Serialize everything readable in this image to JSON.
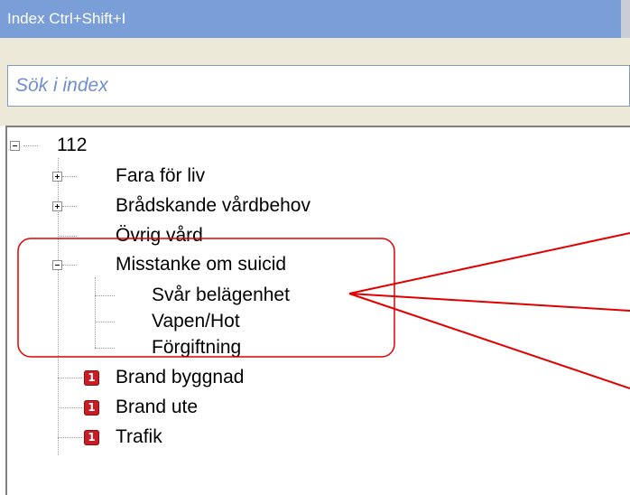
{
  "window": {
    "title": "Index Ctrl+Shift+I"
  },
  "search": {
    "placeholder": "Sök i index",
    "value": ""
  },
  "tree": {
    "root": {
      "label": "112",
      "expanded": true
    },
    "items": [
      {
        "label": "Fara för liv",
        "expanded": false
      },
      {
        "label": "Brådskande vårdbehov",
        "expanded": false
      },
      {
        "label": "Övrig vård"
      },
      {
        "label": "Misstanke om suicid",
        "expanded": true,
        "children": [
          {
            "label": "Svår belägenhet"
          },
          {
            "label": "Vapen/Hot"
          },
          {
            "label": "Förgiftning"
          }
        ]
      },
      {
        "label": "Brand byggnad",
        "badge": "1"
      },
      {
        "label": "Brand ute",
        "badge": "1"
      },
      {
        "label": "Trafik",
        "badge": "1"
      }
    ]
  },
  "colors": {
    "titlebar": "#7a9ed8",
    "annotation": "#e00000",
    "badge": "#c81d25",
    "panel": "#ece9d8"
  },
  "icons": {
    "expand": "plus-box-icon",
    "collapse": "minus-box-icon",
    "badge": "priority-one-badge-icon"
  }
}
